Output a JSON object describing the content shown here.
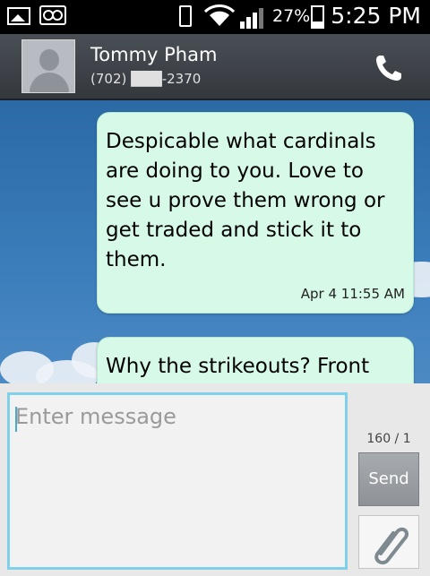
{
  "status_bar": {
    "battery_percent": "27%",
    "time": "5:25 PM",
    "icons": [
      "gallery-icon",
      "voicemail-icon",
      "vibrate-icon",
      "wifi-icon",
      "signal-icon",
      "battery-icon"
    ]
  },
  "header": {
    "contact_name": "Tommy Pham",
    "contact_number": "(702) ███-2370",
    "call_icon": "phone-icon"
  },
  "conversation": {
    "messages": [
      {
        "text": "Despicable what cardinals are doing to you. Love to see u prove them wrong or get traded and stick it to them.",
        "time": "Apr 4 11:55 AM"
      },
      {
        "text": "Why the strikeouts? Front",
        "time": ""
      }
    ]
  },
  "composer": {
    "placeholder": "Enter message",
    "char_count": "160 / 1",
    "send_label": "Send",
    "attach_icon": "paperclip-icon",
    "accent_color": "#7fd0e8"
  }
}
